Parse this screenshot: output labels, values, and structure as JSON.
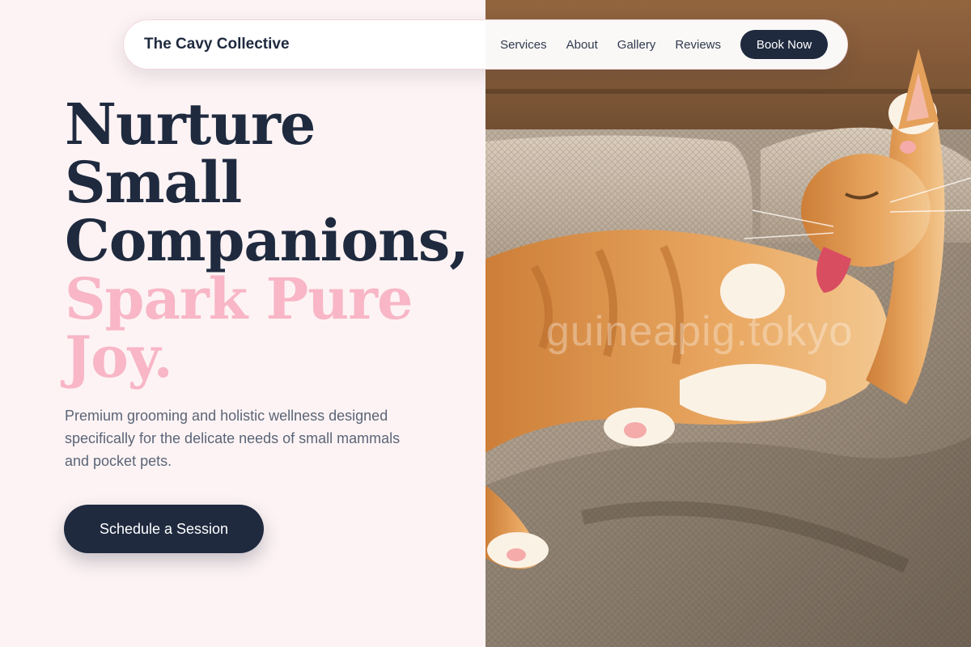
{
  "nav": {
    "brand": "The Cavy Collective",
    "links": [
      {
        "label": "Services"
      },
      {
        "label": "About"
      },
      {
        "label": "Gallery"
      },
      {
        "label": "Reviews"
      }
    ],
    "cta_label": "Book Now"
  },
  "hero": {
    "headline_lines": [
      "Nurture",
      "Small",
      "Companions,"
    ],
    "accent_lines": [
      "Spark Pure",
      "Joy."
    ],
    "subtitle": "Premium grooming and holistic wellness designed specifically for the delicate needs of small mammals and pocket pets.",
    "cta_label": "Schedule a Session"
  },
  "image": {
    "description_icon": "cat-photo",
    "watermark": "guineapig.tokyo"
  },
  "colors": {
    "background": "#fdf3f4",
    "navy": "#1f2a3f",
    "accent_pink": "#f8b6c6",
    "muted_text": "#5b6577"
  }
}
